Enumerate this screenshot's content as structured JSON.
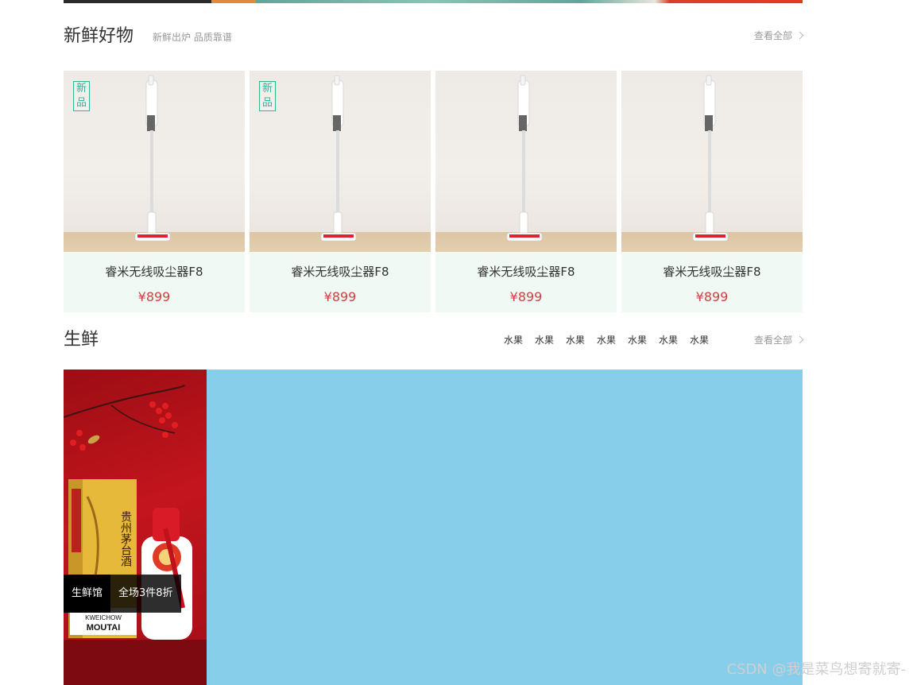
{
  "new_goods": {
    "title": "新鲜好物",
    "subtitle": "新鲜出炉 品质靠谱",
    "view_all": "查看全部",
    "badge_chars": [
      "新",
      "品"
    ],
    "products": [
      {
        "name": "睿米无线吸尘器F8",
        "price": "¥899",
        "is_new": true
      },
      {
        "name": "睿米无线吸尘器F8",
        "price": "¥899",
        "is_new": true
      },
      {
        "name": "睿米无线吸尘器F8",
        "price": "¥899",
        "is_new": false
      },
      {
        "name": "睿米无线吸尘器F8",
        "price": "¥899",
        "is_new": false
      }
    ]
  },
  "fresh": {
    "title": "生鲜",
    "tabs": [
      "水果",
      "水果",
      "水果",
      "水果",
      "水果",
      "水果",
      "水果"
    ],
    "view_all": "查看全部",
    "promo_hall": "生鲜馆",
    "promo_offer": "全场3件8折",
    "panel_color": "#87ceeb",
    "box_brand": "KWEICHOW",
    "box_logo": "MOUTAI",
    "box_chinese": "贵州茅台酒"
  },
  "watermark": "CSDN @我是菜鸟想寄就寄-",
  "colors": {
    "accent": "#27ba9b",
    "price": "#cf4444",
    "card_bg": "#f0f9f4"
  }
}
